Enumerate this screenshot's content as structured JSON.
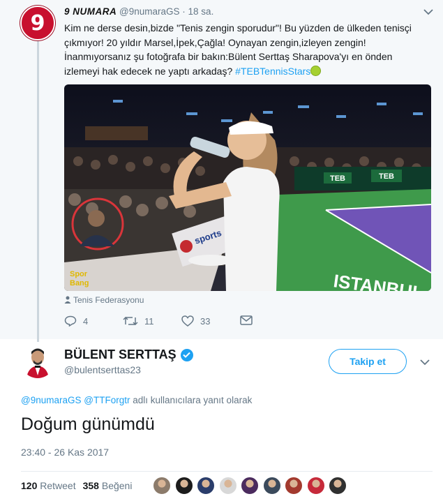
{
  "parent_tweet": {
    "avatar_text": "9",
    "name": "9 NUMARA",
    "handle": "@9numaraGS",
    "time": "· 18 sa.",
    "text_before": "Kim ne derse desin,bizde \"Tenis zengin sporudur\"! Bu yüzden de ülkeden tenisçi çıkmıyor! 20 yıldır Marsel,İpek,Çağla! Oynayan zengin,izleyen zengin! İnanmıyorsanız şu fotoğrafa  bir bakın:Bülent Serttaş Sharapova'yı en önden izlemeyi hak edecek ne yaptı arkadaş? ",
    "hashtag": "#TEBTennisStars",
    "photo_texts": {
      "watermark_1": "Spor",
      "watermark_2": "Bang",
      "court_text": "ISTANBUL",
      "sponsor": "sports",
      "banner_1": "TEB",
      "banner_2": "TEB"
    },
    "location": "Tenis Federasyonu",
    "actions": {
      "replies": "4",
      "retweets": "11",
      "likes": "33"
    }
  },
  "reply_tweet": {
    "name": "BÜLENT SERTTAŞ",
    "handle": "@bulentserttas23",
    "follow_label": "Takip et",
    "reply_to_mention_1": "@9numaraGS",
    "reply_to_mention_2": "@TTForgtr",
    "reply_to_suffix": "adlı kullanıcılara yanıt olarak",
    "text": "Doğum günümdü",
    "time": "23:40 - 26 Kas 2017",
    "retweet_count": "120",
    "retweet_label": "Retweet",
    "like_count": "358",
    "like_label": "Beğeni"
  },
  "colors": {
    "accent": "#1da1f2",
    "muted": "#657786",
    "brand_red": "#c8102e",
    "liker_colors": [
      "#8c7b6b",
      "#1c1c1c",
      "#2a3d6b",
      "#d8d8d8",
      "#4b2b5e",
      "#3b4a5c",
      "#a33a2e",
      "#c62a3a",
      "#303030"
    ]
  }
}
